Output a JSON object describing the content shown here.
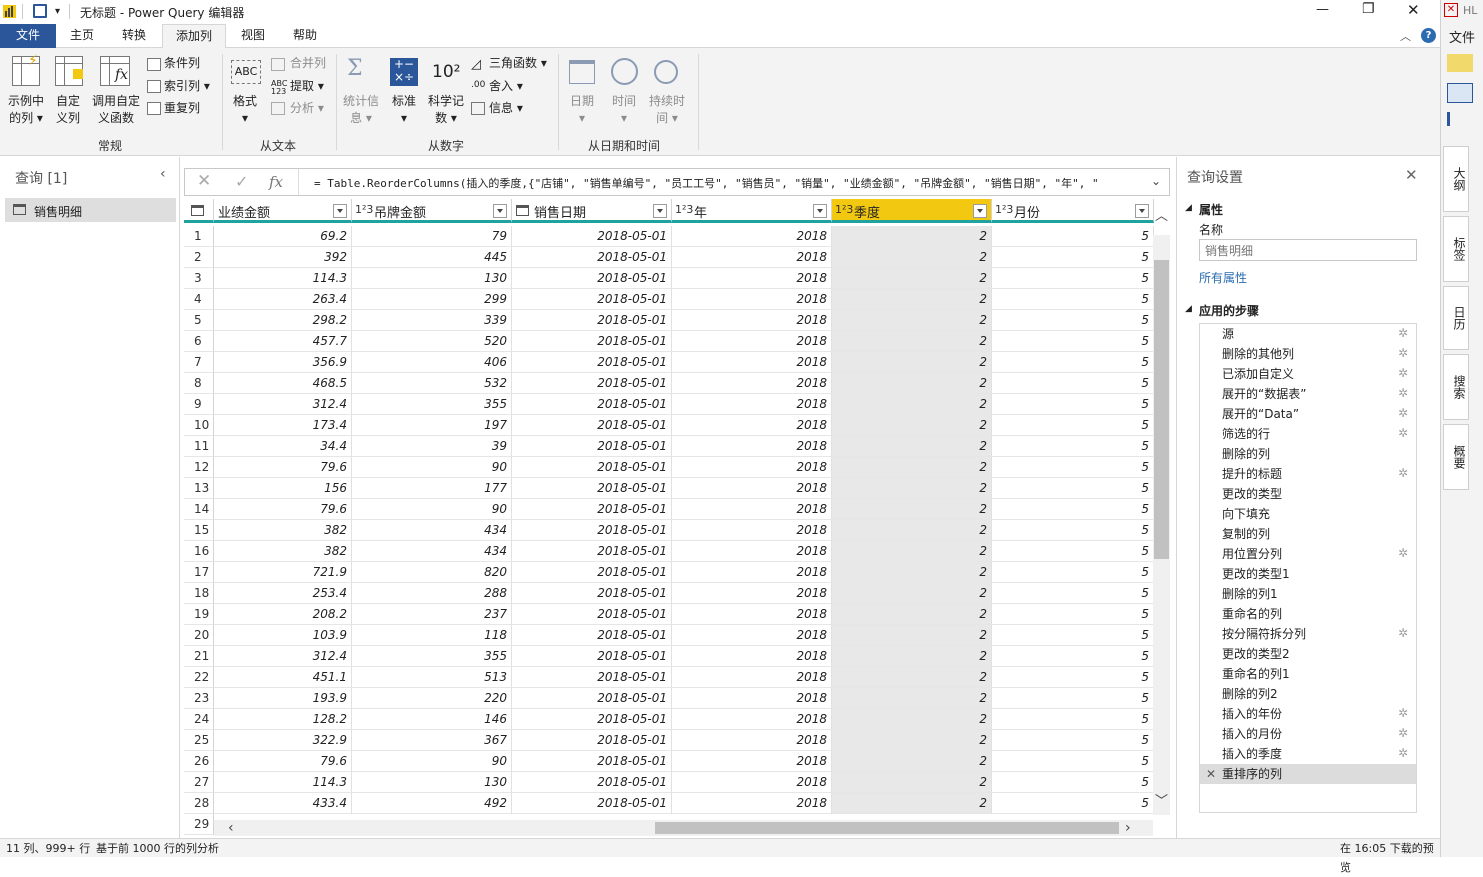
{
  "titlebar": {
    "title": "无标题 - Power Query 编辑器",
    "minimize": "—",
    "restore": "❐",
    "close": "✕"
  },
  "menu": {
    "tabs": [
      "文件",
      "主页",
      "转换",
      "添加列",
      "视图",
      "帮助"
    ],
    "active": "添加列",
    "help_icon": "?"
  },
  "ribbon": {
    "groups": {
      "general": "常规",
      "from_text": "从文本",
      "from_number": "从数字",
      "from_datetime": "从日期和时间"
    },
    "buttons": {
      "col_from_examples": "示例中的列",
      "custom_column": "自定义列",
      "invoke_custom_function": "调用自定义函数",
      "conditional_column": "条件列",
      "index_column": "索引列",
      "duplicate_column": "重复列",
      "format": "格式",
      "merge_columns": "合并列",
      "extract": "提取",
      "parse": "分析",
      "statistics": "统计信息",
      "standard": "标准",
      "scientific": "科学记数",
      "trigonometry": "三角函数",
      "rounding": "舍入",
      "information": "信息",
      "date": "日期",
      "time": "时间",
      "duration": "持续时间"
    }
  },
  "queries_pane": {
    "header": "查询 [1]",
    "items": [
      "销售明细"
    ]
  },
  "formula": {
    "text": "= Table.ReorderColumns(插入的季度,{\"店铺\", \"销售单编号\", \"员工工号\", \"销售员\", \"销量\", \"业绩金额\", \"吊牌金额\", \"销售日期\", \"年\", \""
  },
  "table": {
    "columns": [
      {
        "type": "",
        "name": "业绩金额"
      },
      {
        "type": "1²3",
        "name": "吊牌金额"
      },
      {
        "type": "",
        "name": "销售日期"
      },
      {
        "type": "1²3",
        "name": "年"
      },
      {
        "type": "1²3",
        "name": "季度"
      },
      {
        "type": "1²3",
        "name": "月份"
      }
    ],
    "rows": [
      [
        "69.2",
        "79",
        "2018-05-01",
        "2018",
        "2",
        "5"
      ],
      [
        "392",
        "445",
        "2018-05-01",
        "2018",
        "2",
        "5"
      ],
      [
        "114.3",
        "130",
        "2018-05-01",
        "2018",
        "2",
        "5"
      ],
      [
        "263.4",
        "299",
        "2018-05-01",
        "2018",
        "2",
        "5"
      ],
      [
        "298.2",
        "339",
        "2018-05-01",
        "2018",
        "2",
        "5"
      ],
      [
        "457.7",
        "520",
        "2018-05-01",
        "2018",
        "2",
        "5"
      ],
      [
        "356.9",
        "406",
        "2018-05-01",
        "2018",
        "2",
        "5"
      ],
      [
        "468.5",
        "532",
        "2018-05-01",
        "2018",
        "2",
        "5"
      ],
      [
        "312.4",
        "355",
        "2018-05-01",
        "2018",
        "2",
        "5"
      ],
      [
        "173.4",
        "197",
        "2018-05-01",
        "2018",
        "2",
        "5"
      ],
      [
        "34.4",
        "39",
        "2018-05-01",
        "2018",
        "2",
        "5"
      ],
      [
        "79.6",
        "90",
        "2018-05-01",
        "2018",
        "2",
        "5"
      ],
      [
        "156",
        "177",
        "2018-05-01",
        "2018",
        "2",
        "5"
      ],
      [
        "79.6",
        "90",
        "2018-05-01",
        "2018",
        "2",
        "5"
      ],
      [
        "382",
        "434",
        "2018-05-01",
        "2018",
        "2",
        "5"
      ],
      [
        "382",
        "434",
        "2018-05-01",
        "2018",
        "2",
        "5"
      ],
      [
        "721.9",
        "820",
        "2018-05-01",
        "2018",
        "2",
        "5"
      ],
      [
        "253.4",
        "288",
        "2018-05-01",
        "2018",
        "2",
        "5"
      ],
      [
        "208.2",
        "237",
        "2018-05-01",
        "2018",
        "2",
        "5"
      ],
      [
        "103.9",
        "118",
        "2018-05-01",
        "2018",
        "2",
        "5"
      ],
      [
        "312.4",
        "355",
        "2018-05-01",
        "2018",
        "2",
        "5"
      ],
      [
        "451.1",
        "513",
        "2018-05-01",
        "2018",
        "2",
        "5"
      ],
      [
        "193.9",
        "220",
        "2018-05-01",
        "2018",
        "2",
        "5"
      ],
      [
        "128.2",
        "146",
        "2018-05-01",
        "2018",
        "2",
        "5"
      ],
      [
        "322.9",
        "367",
        "2018-05-01",
        "2018",
        "2",
        "5"
      ],
      [
        "79.6",
        "90",
        "2018-05-01",
        "2018",
        "2",
        "5"
      ],
      [
        "114.3",
        "130",
        "2018-05-01",
        "2018",
        "2",
        "5"
      ],
      [
        "433.4",
        "492",
        "2018-05-01",
        "2018",
        "2",
        "5"
      ]
    ],
    "last_row_number": "29"
  },
  "settings": {
    "header": "查询设置",
    "properties_label": "属性",
    "name_label": "名称",
    "name_value": "销售明细",
    "all_properties": "所有属性",
    "steps_label": "应用的步骤",
    "steps": [
      {
        "name": "源",
        "gear": true
      },
      {
        "name": "删除的其他列",
        "gear": true
      },
      {
        "name": "已添加自定义",
        "gear": true
      },
      {
        "name": "展开的“数据表”",
        "gear": true
      },
      {
        "name": "展开的“Data”",
        "gear": true
      },
      {
        "name": "筛选的行",
        "gear": true
      },
      {
        "name": "删除的列",
        "gear": false
      },
      {
        "name": "提升的标题",
        "gear": true
      },
      {
        "name": "更改的类型",
        "gear": false
      },
      {
        "name": "向下填充",
        "gear": false
      },
      {
        "name": "复制的列",
        "gear": false
      },
      {
        "name": "用位置分列",
        "gear": true
      },
      {
        "name": "更改的类型1",
        "gear": false
      },
      {
        "name": "删除的列1",
        "gear": false
      },
      {
        "name": "重命名的列",
        "gear": false
      },
      {
        "name": "按分隔符拆分列",
        "gear": true
      },
      {
        "name": "更改的类型2",
        "gear": false
      },
      {
        "name": "重命名的列1",
        "gear": false
      },
      {
        "name": "删除的列2",
        "gear": false
      },
      {
        "name": "插入的年份",
        "gear": true
      },
      {
        "name": "插入的月份",
        "gear": true
      },
      {
        "name": "插入的季度",
        "gear": true
      },
      {
        "name": "重排序的列",
        "gear": false
      }
    ]
  },
  "status": {
    "left": "11 列、999+ 行",
    "middle": "基于前 1000 行的列分析",
    "right": "在 16:05 下载的预览"
  },
  "sidebar": {
    "file": "文件",
    "user": "HL",
    "tabs": [
      "大纲",
      "标签",
      "日历",
      "搜索",
      "概要"
    ]
  },
  "colors": {
    "accent": "#f2c811",
    "header_bar": "#20a39e",
    "menu_active": "#2b579a",
    "link": "#2b6cb0"
  }
}
